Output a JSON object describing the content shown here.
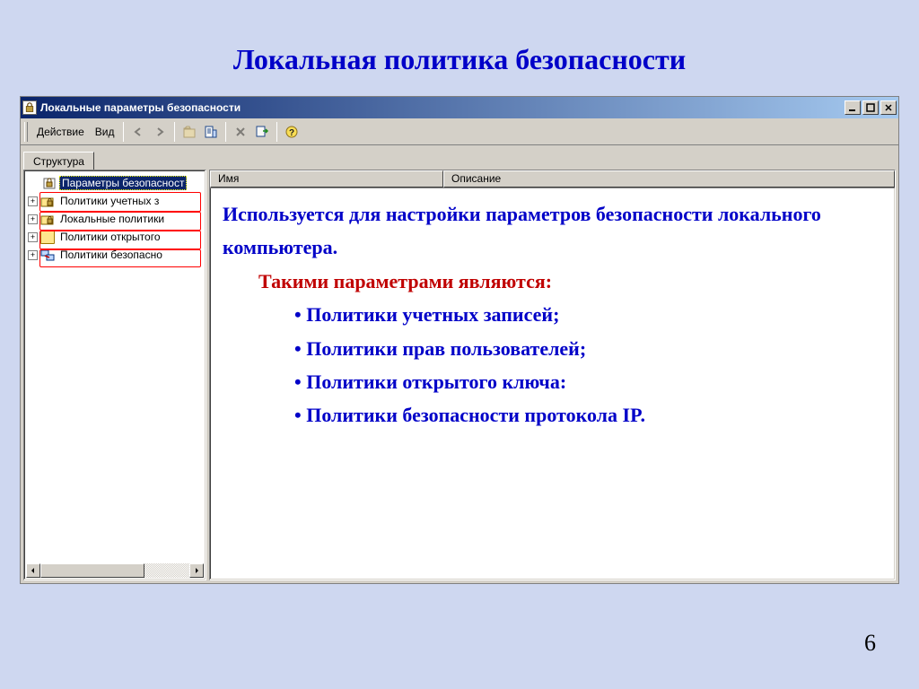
{
  "slide": {
    "title": "Локальная политика безопасности",
    "page_number": "6"
  },
  "window": {
    "title": "Локальные параметры безопасности",
    "toolbar": {
      "action": "Действие",
      "view": "Вид"
    },
    "tree_tab": "Структура",
    "tree": {
      "root": "Параметры безопасност",
      "items": [
        "Политики учетных з",
        "Локальные политики",
        "Политики открытого",
        "Политики безопасно"
      ]
    },
    "list_columns": {
      "name": "Имя",
      "description": "Описание"
    }
  },
  "overlay": {
    "intro": "Используется для настройки параметров безопасности локального компьютера.",
    "heading": "Такими параметрами являются:",
    "bullets": [
      "Политики учетных записей;",
      "Политики прав пользователей;",
      "Политики открытого ключа:",
      "Политики безопасности протокола IP."
    ]
  }
}
